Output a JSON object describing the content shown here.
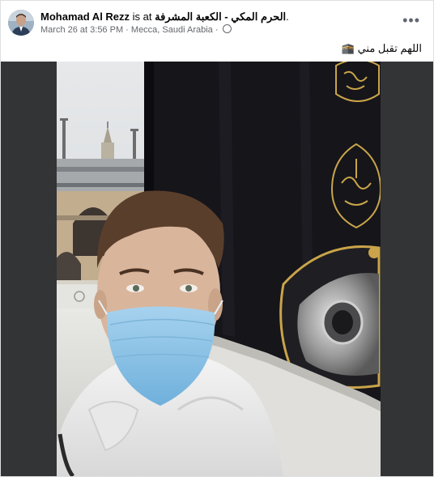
{
  "post": {
    "author": "Mohamad Al Rezz",
    "is_at": "is at",
    "location_name": "الحرم المكي - الكعبة المشرفة",
    "location_suffix": ".",
    "date": "March 26 at 3:56 PM",
    "separator": "·",
    "place": "Mecca, Saudi Arabia",
    "separator2": "·",
    "more_icon": "more-options-icon",
    "more_label": "•••",
    "caption_text": "اللهم تقبل مني",
    "caption_emoji": "🕋"
  },
  "photo": {
    "calligraphy_top": "الله أكبر",
    "calligraphy_mid": "الله أكبر"
  },
  "colors": {
    "author": "#050505",
    "meta": "#65676b",
    "media_bg": "#333435",
    "kaaba_black": "#15151a",
    "gold": "#c9a44a",
    "mask_blue": "#8fc3e3"
  }
}
